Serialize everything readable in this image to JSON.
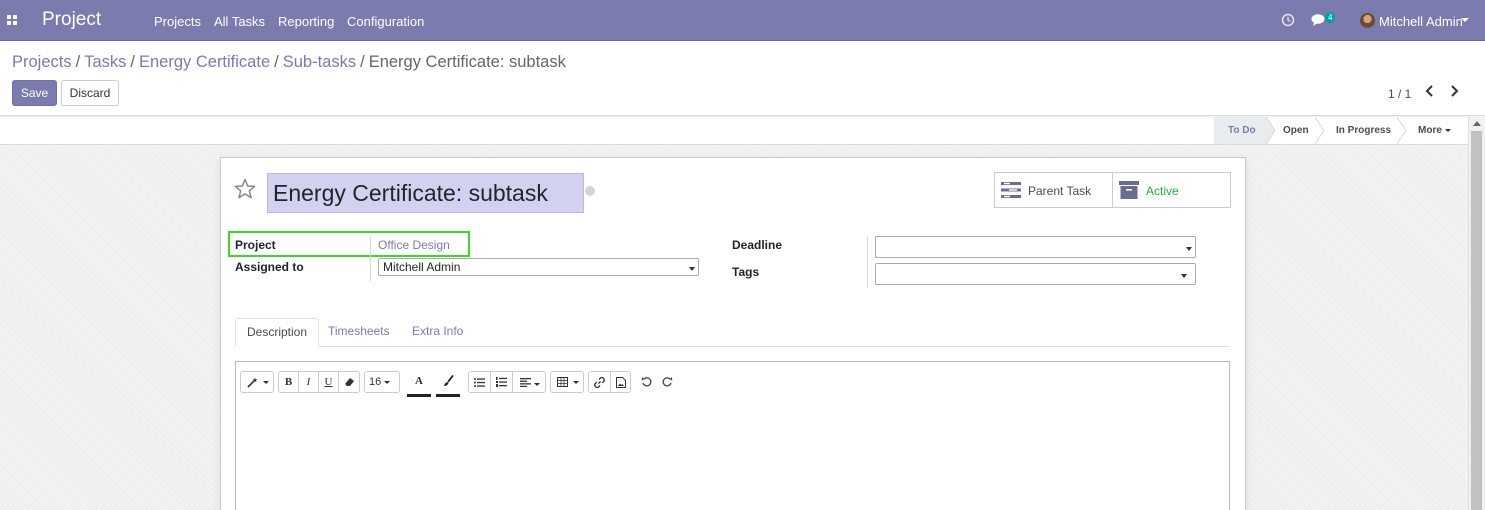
{
  "navbar": {
    "brand": "Project",
    "menu": [
      "Projects",
      "All Tasks",
      "Reporting",
      "Configuration"
    ],
    "messages_count": "4",
    "user": "Mitchell Admin"
  },
  "breadcrumb": {
    "items": [
      "Projects",
      "Tasks",
      "Energy Certificate",
      "Sub-tasks"
    ],
    "current": "Energy Certificate: subtask",
    "separator": "/"
  },
  "buttons": {
    "save": "Save",
    "discard": "Discard"
  },
  "pager": {
    "value": "1 / 1"
  },
  "stages": {
    "items": [
      "To Do",
      "Open",
      "In Progress"
    ],
    "active": "To Do",
    "more": "More"
  },
  "task": {
    "title": "Energy Certificate: subtask",
    "smart_buttons": {
      "parent_task": "Parent Task",
      "active": "Active"
    },
    "fields": {
      "project_label": "Project",
      "project_value": "Office Design",
      "assigned_label": "Assigned to",
      "assigned_value": "Mitchell Admin",
      "deadline_label": "Deadline",
      "deadline_value": "",
      "tags_label": "Tags",
      "tags_value": ""
    },
    "tabs": [
      "Description",
      "Timesheets",
      "Extra Info"
    ],
    "active_tab": "Description"
  },
  "editor": {
    "font_size": "16",
    "bold": "B",
    "italic": "I",
    "underline": "U",
    "font_color": "A"
  },
  "colors": {
    "brand": "#7c7bad",
    "highlight": "#42d429",
    "active_green": "#28a745",
    "title_bg": "#d2d2f0"
  }
}
